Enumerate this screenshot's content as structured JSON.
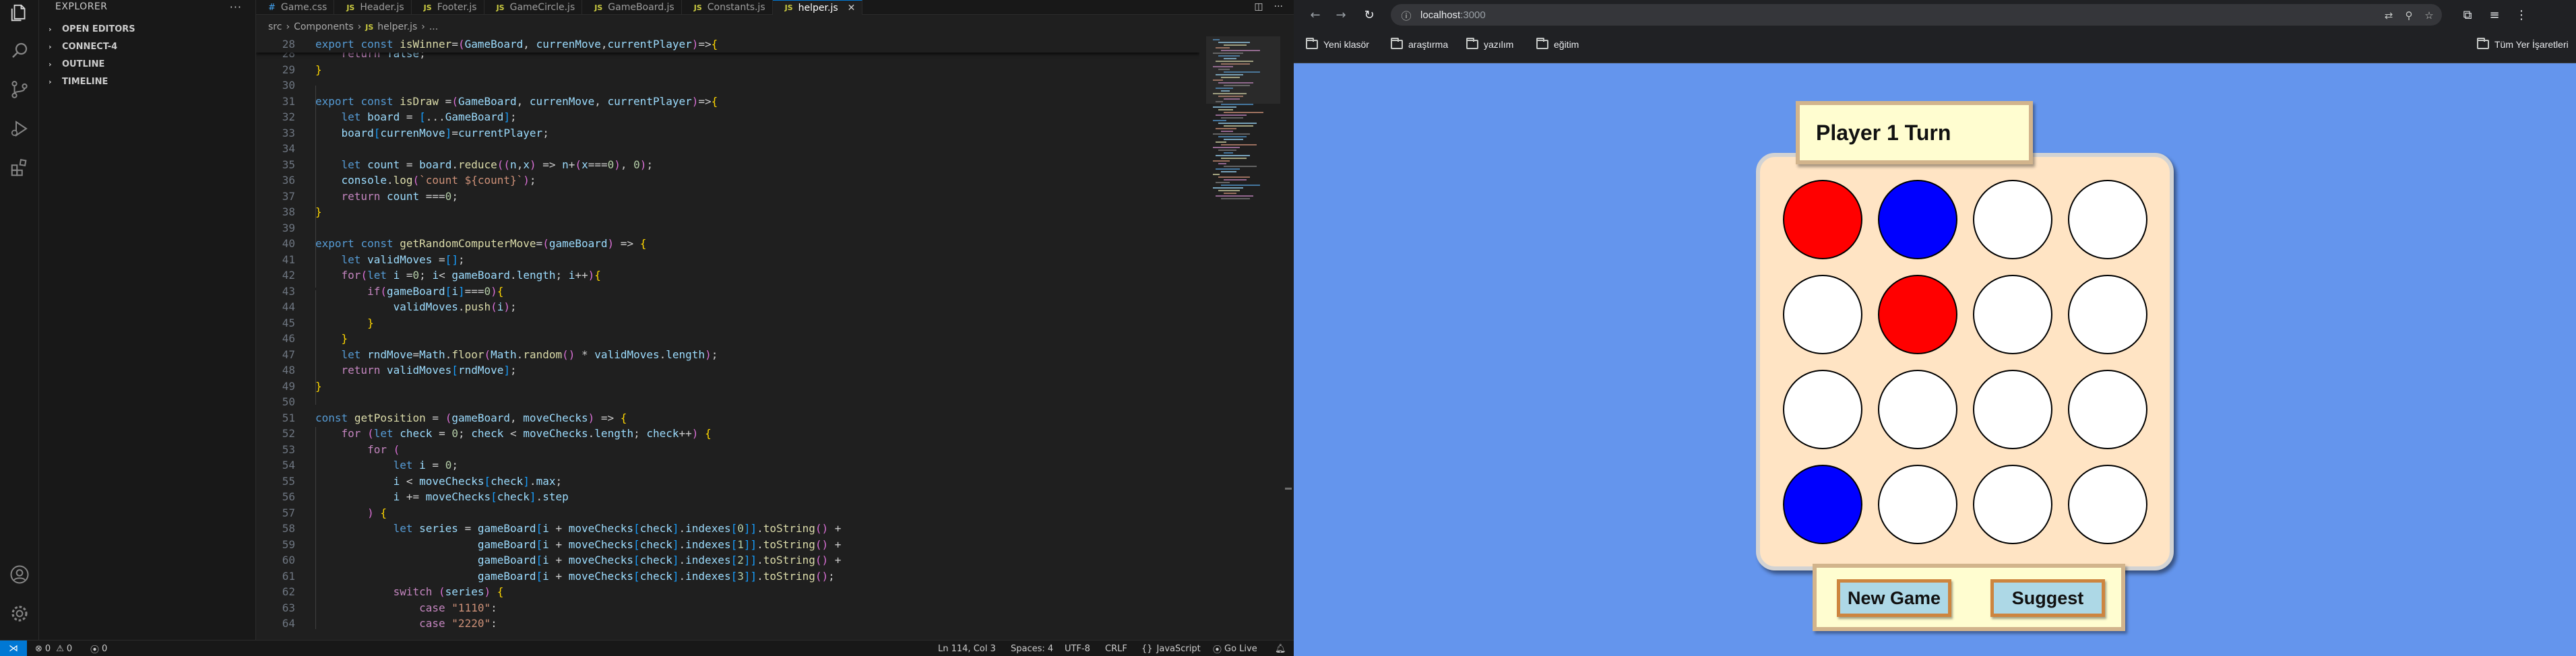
{
  "vscode": {
    "sidebar": {
      "title": "EXPLORER",
      "sections": [
        {
          "label": "OPEN EDITORS"
        },
        {
          "label": "CONNECT-4"
        },
        {
          "label": "OUTLINE"
        },
        {
          "label": "TIMELINE"
        }
      ]
    },
    "tabs": [
      {
        "label": "Game.css",
        "icon": "css"
      },
      {
        "label": "Header.js",
        "icon": "js"
      },
      {
        "label": "Footer.js",
        "icon": "js"
      },
      {
        "label": "GameCircle.js",
        "icon": "js"
      },
      {
        "label": "GameBoard.js",
        "icon": "js"
      },
      {
        "label": "Constants.js",
        "icon": "js"
      },
      {
        "label": "helper.js",
        "icon": "js",
        "active": true
      }
    ],
    "breadcrumb": {
      "part1": "src",
      "part2": "Components",
      "file_icon": "JS",
      "file": "helper.js",
      "tail": "..."
    },
    "code": {
      "sticky_line": {
        "n": "28",
        "text": "export const isWinner=(GameBoard, currenMove,currentPlayer)=>{"
      },
      "lines": [
        {
          "n": "28",
          "text": "    return false;"
        },
        {
          "n": "29",
          "text": "}"
        },
        {
          "n": "30",
          "text": ""
        },
        {
          "n": "31",
          "text": "export const isDraw =(GameBoard, currenMove, currentPlayer)=>{"
        },
        {
          "n": "32",
          "text": "    let board = [...GameBoard];"
        },
        {
          "n": "33",
          "text": "    board[currenMove]=currentPlayer;"
        },
        {
          "n": "34",
          "text": ""
        },
        {
          "n": "35",
          "text": "    let count = board.reduce((n,x) => n+(x===0), 0);"
        },
        {
          "n": "36",
          "text": "    console.log(`count ${count}`);"
        },
        {
          "n": "37",
          "text": "    return count ===0;"
        },
        {
          "n": "38",
          "text": "}"
        },
        {
          "n": "39",
          "text": ""
        },
        {
          "n": "40",
          "text": "export const getRandomComputerMove=(gameBoard) => {"
        },
        {
          "n": "41",
          "text": "    let validMoves =[];"
        },
        {
          "n": "42",
          "text": "    for(let i =0; i< gameBoard.length; i++){"
        },
        {
          "n": "43",
          "text": "        if(gameBoard[i]===0){"
        },
        {
          "n": "44",
          "text": "            validMoves.push(i);"
        },
        {
          "n": "45",
          "text": "        }"
        },
        {
          "n": "46",
          "text": "    }"
        },
        {
          "n": "47",
          "text": "    let rndMove=Math.floor(Math.random() * validMoves.length);"
        },
        {
          "n": "48",
          "text": "    return validMoves[rndMove];"
        },
        {
          "n": "49",
          "text": "}"
        },
        {
          "n": "50",
          "text": ""
        },
        {
          "n": "51",
          "text": "const getPosition = (gameBoard, moveChecks) => {"
        },
        {
          "n": "52",
          "text": "    for (let check = 0; check < moveChecks.length; check++) {"
        },
        {
          "n": "53",
          "text": "        for ("
        },
        {
          "n": "54",
          "text": "            let i = 0;"
        },
        {
          "n": "55",
          "text": "            i < moveChecks[check].max;"
        },
        {
          "n": "56",
          "text": "            i += moveChecks[check].step"
        },
        {
          "n": "57",
          "text": "        ) {"
        },
        {
          "n": "58",
          "text": "            let series = gameBoard[i + moveChecks[check].indexes[0]].toString() +"
        },
        {
          "n": "59",
          "text": "                         gameBoard[i + moveChecks[check].indexes[1]].toString() +"
        },
        {
          "n": "60",
          "text": "                         gameBoard[i + moveChecks[check].indexes[2]].toString() +"
        },
        {
          "n": "61",
          "text": "                         gameBoard[i + moveChecks[check].indexes[3]].toString();"
        },
        {
          "n": "62",
          "text": "            switch (series) {"
        },
        {
          "n": "63",
          "text": "                case \"1110\":"
        },
        {
          "n": "64",
          "text": "                case \"2220\":"
        }
      ]
    },
    "statusbar": {
      "errors": "0",
      "warnings": "0",
      "ports": "0",
      "position": "Ln 114, Col 3",
      "spaces": "Spaces: 4",
      "encoding": "UTF-8",
      "eol": "CRLF",
      "language": "JavaScript",
      "golive": "Go Live"
    }
  },
  "browser": {
    "url_host": "localhost",
    "url_port": ":3000",
    "bookmarks": [
      {
        "label": "Yeni klasör"
      },
      {
        "label": "araştırma"
      },
      {
        "label": "yazılım"
      },
      {
        "label": "eğitim"
      }
    ],
    "all_bookmarks": "Tüm Yer İşaretleri",
    "game": {
      "turn_text": "Player 1 Turn",
      "board": [
        "red",
        "blue",
        "white",
        "white",
        "white",
        "red",
        "white",
        "white",
        "white",
        "white",
        "white",
        "white",
        "blue",
        "white",
        "white",
        "white"
      ],
      "colors": {
        "red": "#ff0000",
        "blue": "#0000ff",
        "white": "#ffffff"
      },
      "new_game_label": "New Game",
      "suggest_label": "Suggest"
    }
  }
}
